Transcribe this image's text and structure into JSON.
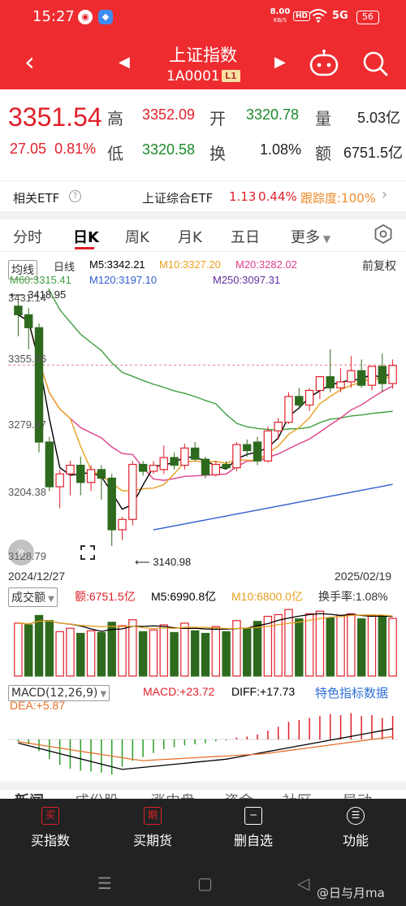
{
  "status": {
    "time": "15:27",
    "speed_value": "8.00",
    "speed_unit": "KB/S",
    "hd": "HD",
    "signal": "5G",
    "battery": "56",
    "app1": "◉",
    "app2": "◆"
  },
  "header": {
    "title": "上证指数",
    "code": "1A0001",
    "level": "L1",
    "back": "‹",
    "prev": "◀",
    "next": "▶"
  },
  "quote": {
    "price": "3351.54",
    "change": "27.05",
    "change_pct": "0.81%",
    "high_label": "高",
    "high": "3352.09",
    "open_label": "开",
    "open": "3320.78",
    "vol_label": "量",
    "vol": "5.03亿",
    "low_label": "低",
    "low": "3320.58",
    "turn_label": "换",
    "turn": "1.08%",
    "amt_label": "额",
    "amt": "6751.5亿"
  },
  "etf": {
    "label": "相关ETF",
    "info": "?",
    "name": "上证综合ETF",
    "price": "1.13",
    "change": "0.44%",
    "tracking": "跟踪度:100%",
    "arrow": "›"
  },
  "tabs": {
    "fenshi": "分时",
    "day": "日K",
    "week": "周K",
    "month": "月K",
    "five": "五日",
    "more": "更多"
  },
  "ma_legend": {
    "select": "均线",
    "period": "日线",
    "ma5": "M5:3342.21",
    "ma10": "M10:3327.20",
    "ma20": "M20:3282.02",
    "ma60": "M60:3315.41",
    "ma120": "M120:3197.10",
    "ma250": "M250:3097.31",
    "adjust": "前复权"
  },
  "price_axis": {
    "p1": "3431.14",
    "p2": "3355.56",
    "p3": "3279.97",
    "p4": "3204.38",
    "p5": "3128.79",
    "max_mark": "3418.95",
    "min_mark": "3140.98"
  },
  "dates": {
    "start": "2024/12/27",
    "end": "2025/02/19"
  },
  "volume": {
    "select": "成交额",
    "amount": "额:6751.5亿",
    "m5": "M5:6990.8亿",
    "m10": "M10:6800.0亿",
    "turnover": "换手率:1.08%"
  },
  "macd": {
    "select": "MACD(12,26,9)",
    "macd": "MACD:+23.72",
    "diff": "DIFF:+17.73",
    "dea": "DEA:+5.87",
    "feature": "特色指标数据"
  },
  "bottom_tabs": {
    "t1": "新闻",
    "t2": "成份股",
    "t3": "涨中盘",
    "t4": "资金",
    "t5": "社区",
    "t6": "异动"
  },
  "bottom_nav": {
    "buy_index": "买指数",
    "buy_index_icon": "买",
    "buy_futures": "买期货",
    "buy_futures_icon": "期",
    "watchlist": "删自选",
    "watchlist_icon": "─",
    "function": "功能",
    "function_icon": "☰"
  },
  "system_nav": {
    "menu": "☰",
    "home": "▢",
    "back": "◁"
  },
  "watermark": "@日与月ma",
  "colors": {
    "up": "#e0202a",
    "down": "#2e6a1e",
    "ma5": "#000000",
    "ma10": "#e8a020",
    "ma20": "#e0408a",
    "ma60": "#40a040",
    "ma120": "#3060d0",
    "ma250": "#6030a0",
    "brand": "#ee2c30"
  },
  "chart_data": {
    "type": "candlestick",
    "ylim": [
      3128.79,
      3431.14
    ],
    "candles": [
      [
        3420,
        3431,
        3385,
        3410
      ],
      [
        3410,
        3418,
        3370,
        3395
      ],
      [
        3395,
        3400,
        3250,
        3262
      ],
      [
        3262,
        3268,
        3205,
        3210
      ],
      [
        3210,
        3230,
        3185,
        3225
      ],
      [
        3225,
        3240,
        3200,
        3235
      ],
      [
        3235,
        3245,
        3200,
        3215
      ],
      [
        3215,
        3235,
        3205,
        3230
      ],
      [
        3230,
        3235,
        3195,
        3220
      ],
      [
        3220,
        3225,
        3141,
        3160
      ],
      [
        3160,
        3175,
        3148,
        3172
      ],
      [
        3172,
        3240,
        3165,
        3236
      ],
      [
        3236,
        3240,
        3223,
        3228
      ],
      [
        3228,
        3240,
        3225,
        3235
      ],
      [
        3230,
        3258,
        3225,
        3244
      ],
      [
        3244,
        3250,
        3230,
        3235
      ],
      [
        3235,
        3260,
        3230,
        3255
      ],
      [
        3255,
        3262,
        3240,
        3242
      ],
      [
        3242,
        3245,
        3220,
        3224
      ],
      [
        3224,
        3240,
        3222,
        3236
      ],
      [
        3236,
        3240,
        3230,
        3232
      ],
      [
        3232,
        3262,
        3228,
        3259
      ],
      [
        3259,
        3265,
        3245,
        3252
      ],
      [
        3262,
        3268,
        3235,
        3240
      ],
      [
        3240,
        3280,
        3238,
        3275
      ],
      [
        3275,
        3290,
        3265,
        3285
      ],
      [
        3285,
        3320,
        3283,
        3315
      ],
      [
        3315,
        3325,
        3300,
        3305
      ],
      [
        3305,
        3325,
        3298,
        3322
      ],
      [
        3322,
        3338,
        3312,
        3338
      ],
      [
        3338,
        3370,
        3320,
        3325
      ],
      [
        3325,
        3348,
        3320,
        3332
      ],
      [
        3332,
        3362,
        3325,
        3345
      ],
      [
        3345,
        3358,
        3325,
        3328
      ],
      [
        3328,
        3350,
        3322,
        3350
      ],
      [
        3350,
        3365,
        3320,
        3330
      ],
      [
        3330,
        3358,
        3324,
        3351
      ]
    ],
    "volume_up": [
      true,
      false,
      false,
      false,
      true,
      true,
      false,
      true,
      false,
      false,
      true,
      true,
      false,
      true,
      true,
      false,
      true,
      false,
      false,
      true,
      false,
      true,
      false,
      false,
      true,
      true,
      true,
      false,
      true,
      true,
      false,
      true,
      true,
      false,
      true,
      false,
      true
    ],
    "volume": [
      6200,
      6000,
      7100,
      6500,
      5200,
      5600,
      5000,
      5300,
      5100,
      6300,
      5900,
      6600,
      5200,
      5400,
      6000,
      5100,
      6200,
      5300,
      5000,
      5800,
      5200,
      6500,
      5600,
      6400,
      7000,
      7200,
      7800,
      6700,
      7300,
      7600,
      6800,
      7100,
      7300,
      6700,
      7100,
      7000,
      6751
    ],
    "macd": [
      -2,
      -5,
      -12,
      -20,
      -26,
      -30,
      -32,
      -33,
      -34,
      -36,
      -28,
      -22,
      -18,
      -14,
      -10,
      -8,
      -6,
      -5,
      -4,
      -2,
      -1,
      2,
      3,
      5,
      9,
      13,
      18,
      20,
      22,
      24,
      26,
      25,
      27,
      24,
      25,
      22,
      24
    ]
  }
}
